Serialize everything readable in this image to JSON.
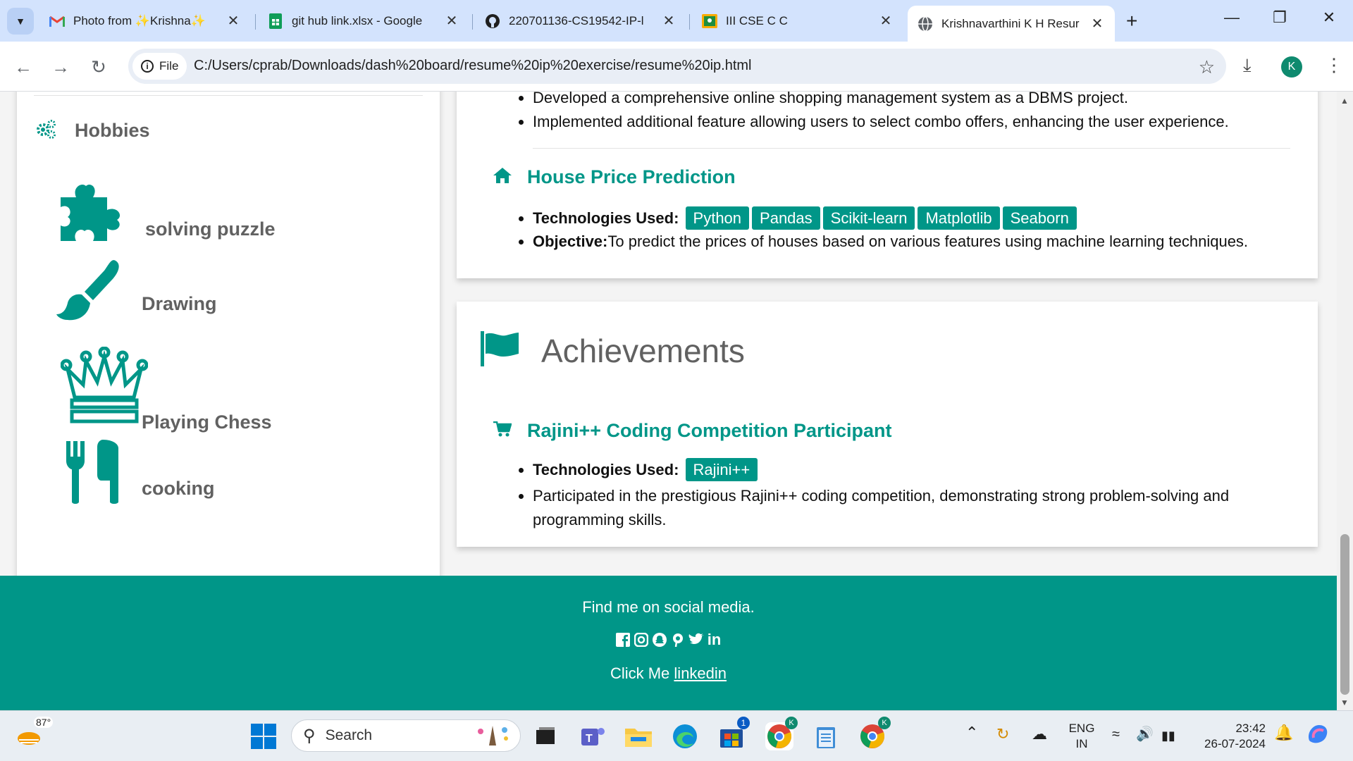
{
  "browser": {
    "tabs": [
      {
        "title": "Photo from ✨Krishna✨",
        "favicon": "gmail-icon"
      },
      {
        "title": "git hub link.xlsx - Google",
        "favicon": "sheets-icon"
      },
      {
        "title": "220701136-CS19542-IP-l",
        "favicon": "github-icon"
      },
      {
        "title": "III CSE C C",
        "favicon": "classroom-icon"
      },
      {
        "title": "Krishnavarthini K H Resur",
        "favicon": "globe-icon",
        "active": true
      }
    ],
    "address_chip": "File",
    "url": "C:/Users/cprab/Downloads/dash%20board/resume%20ip%20exercise/resume%20ip.html",
    "profile_initial": "K"
  },
  "hobbies": {
    "heading": "Hobbies",
    "items": [
      {
        "label": "solving puzzle",
        "icon": "puzzle-icon"
      },
      {
        "label": "Drawing",
        "icon": "paintbrush-icon"
      },
      {
        "label": "Playing Chess",
        "icon": "chess-queen-icon"
      },
      {
        "label": "cooking",
        "icon": "cutlery-icon"
      }
    ]
  },
  "projects": {
    "prev_bullets": [
      "Developed a comprehensive online shopping management system as a DBMS project.",
      "Implemented additional feature allowing users to select combo offers, enhancing the user experience."
    ],
    "house": {
      "title": "House Price Prediction",
      "tech_label": "Technologies Used:",
      "techs": [
        "Python",
        "Pandas",
        "Scikit-learn",
        "Matplotlib",
        "Seaborn"
      ],
      "objective_label": "Objective:",
      "objective": "To predict the prices of houses based on various features using machine learning techniques."
    }
  },
  "achievements": {
    "heading": "Achievements",
    "item": {
      "title": "Rajini++ Coding Competition Participant",
      "tech_label": "Technologies Used:",
      "techs": [
        "Rajini++"
      ],
      "description": "Participated in the prestigious Rajini++ coding competition, demonstrating strong problem-solving and programming skills."
    }
  },
  "footer": {
    "social_text": "Find me on social media.",
    "click_text": "Click Me",
    "link_text": "linkedin"
  },
  "taskbar": {
    "weather": "87°",
    "search_placeholder": "Search",
    "lang_top": "ENG",
    "lang_bottom": "IN",
    "time": "23:42",
    "date": "26-07-2024",
    "store_badge": "1"
  },
  "colors": {
    "accent": "#009688",
    "tabstrip": "#d3e3fd"
  }
}
